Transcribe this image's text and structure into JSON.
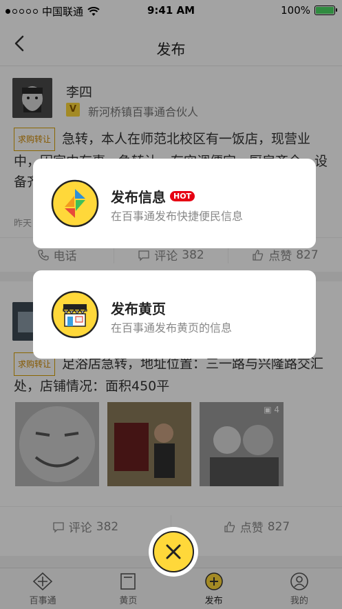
{
  "status_bar": {
    "carrier": "中国联通",
    "time": "9:41 AM",
    "battery": "100%"
  },
  "nav": {
    "title": "发布"
  },
  "feed": {
    "post1": {
      "user": "李四",
      "role": "新河桥镇百事通合伙人",
      "badge": "V",
      "tag": "求购转让",
      "text": "急转，本人在师范北校区有一饭店，现营业中，因家中有事，急转让，有空调便宜，厨房齐全，设备齐全，有意向者请联系，饭店面议",
      "time": "昨天",
      "phone_label": "电话",
      "comment_label": "评论",
      "comment_count": "382",
      "like_label": "点赞",
      "like_count": "827"
    },
    "post2": {
      "tag": "求购转让",
      "text": "足浴店急转，地址位置：三一路与兴隆路交汇处，店铺情况：面积450平",
      "photo_count": "4",
      "comment_label": "评论",
      "comment_count": "382",
      "like_label": "点赞",
      "like_count": "827"
    }
  },
  "tabbar": {
    "items": [
      {
        "label": "百事通"
      },
      {
        "label": "黄页"
      },
      {
        "label": "发布"
      },
      {
        "label": "我的"
      }
    ]
  },
  "popup": {
    "option1": {
      "title": "发布信息",
      "badge": "HOT",
      "desc": "在百事通发布快捷便民信息"
    },
    "option2": {
      "title": "发布黄页",
      "desc": "在百事通发布黄页的信息"
    }
  },
  "colors": {
    "accent": "#ffd83a",
    "hot": "#e60012"
  }
}
